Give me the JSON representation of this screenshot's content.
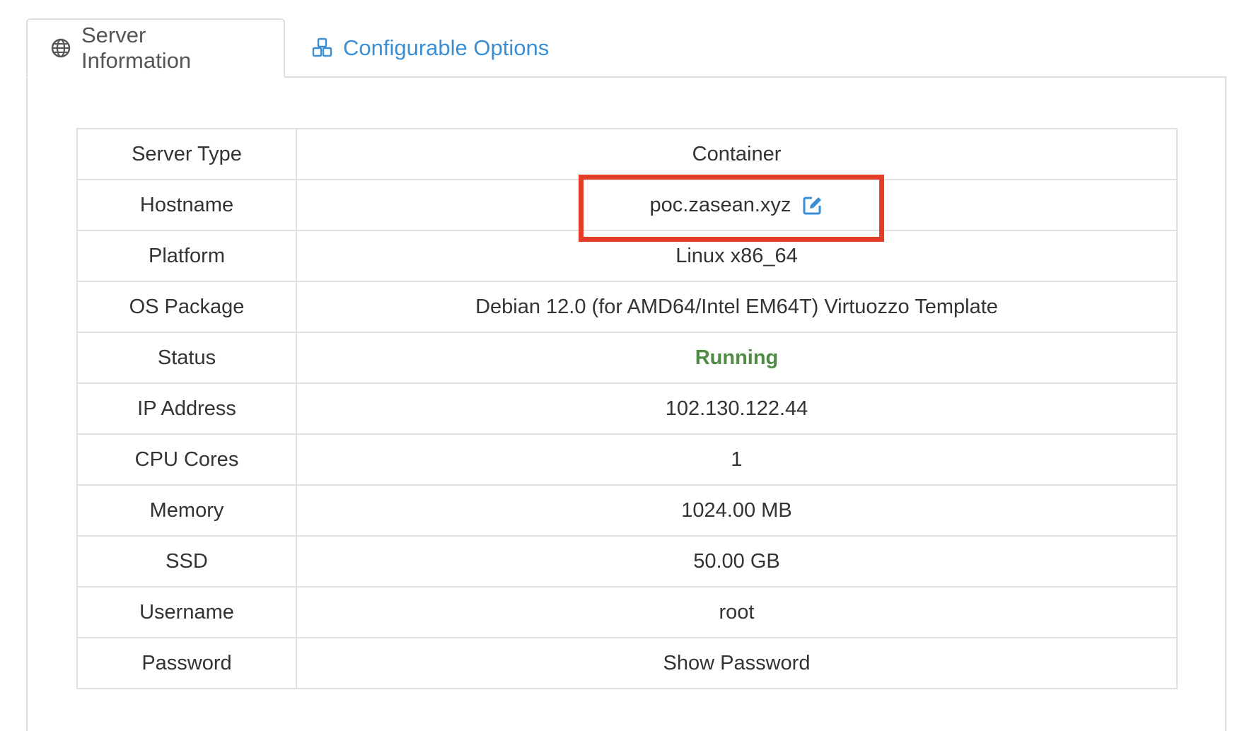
{
  "tabs": [
    {
      "label": "Server Information",
      "icon": "globe-icon",
      "active": true
    },
    {
      "label": "Configurable Options",
      "icon": "cubes-icon",
      "active": false
    }
  ],
  "colors": {
    "link": "#3a8fd4",
    "status_running": "#4e8c43",
    "highlight": "#e53c2a",
    "border": "#dddddd"
  },
  "server_info": {
    "server_type": {
      "label": "Server Type",
      "value": "Container"
    },
    "hostname": {
      "label": "Hostname",
      "value": "poc.zasean.xyz",
      "icon": "edit-icon"
    },
    "platform": {
      "label": "Platform",
      "value": "Linux x86_64"
    },
    "os_package": {
      "label": "OS Package",
      "value": "Debian 12.0 (for AMD64/Intel EM64T) Virtuozzo Template"
    },
    "status": {
      "label": "Status",
      "value": "Running"
    },
    "ip_address": {
      "label": "IP Address",
      "value": "102.130.122.44"
    },
    "cpu_cores": {
      "label": "CPU Cores",
      "value": "1"
    },
    "memory": {
      "label": "Memory",
      "value": "1024.00 MB"
    },
    "ssd": {
      "label": "SSD",
      "value": "50.00 GB"
    },
    "username": {
      "label": "Username",
      "value": "root"
    },
    "password": {
      "label": "Password",
      "value": "Show Password"
    }
  }
}
